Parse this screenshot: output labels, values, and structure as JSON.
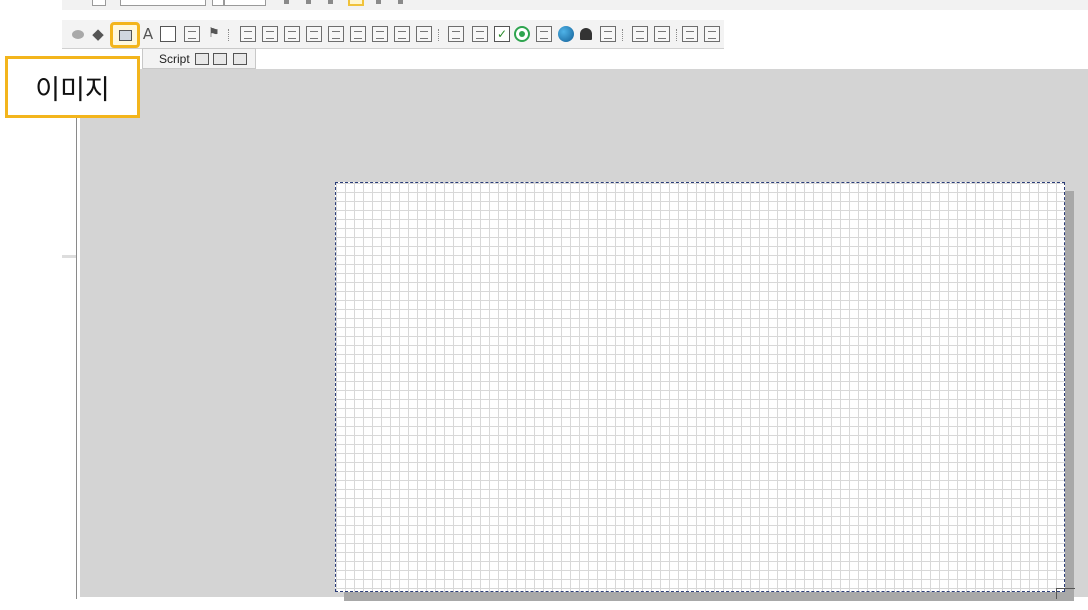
{
  "tabs": {
    "script_label": "Script"
  },
  "callout": {
    "label": "이미지"
  },
  "toolbar": {
    "highlighted_tool": "image-tool",
    "highlight_color": "#f3b51c",
    "tools": [
      "ellipse-tool-icon",
      "polygon-tool-icon",
      "image-tool-icon",
      "text-tool-icon",
      "sound-tool-icon",
      "picture-tool-icon",
      "flag-tool-icon",
      "bar-chart-icon",
      "align-left-icon",
      "xy-plot-icon",
      "vertical-bar-icon",
      "pie-chart-icon",
      "gauge-icon",
      "meter-icon",
      "tank-icon",
      "cube-icon",
      "text-field-icon",
      "listbox-icon",
      "checkbox-icon",
      "radio-button-icon",
      "table-icon",
      "globe-icon",
      "bell-icon",
      "alarm-lamp-icon",
      "label-icon",
      "grid-table-icon",
      "trend-chart-icon",
      "line-chart-icon"
    ]
  },
  "colors": {
    "workspace": "#d4d4d4",
    "canvas_border": "#2b3d78",
    "grid": "#d8d8d8"
  }
}
